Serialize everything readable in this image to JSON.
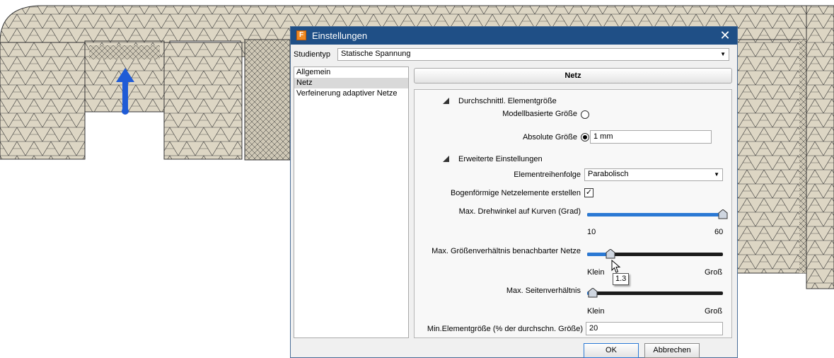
{
  "dialog": {
    "title": "Einstellungen",
    "close_glyph": "✕",
    "icon_letter": "F"
  },
  "study": {
    "label": "Studientyp",
    "value": "Statische Spannung"
  },
  "nav": {
    "items": [
      "Allgemein",
      "Netz",
      "Verfeinerung adaptiver Netze"
    ],
    "selected_index": 1
  },
  "panel": {
    "header": "Netz",
    "avg_section": "Durchschnittl. Elementgröße",
    "model_based_label": "Modellbasierte Größe",
    "absolute_label": "Absolute Größe",
    "absolute_value": "1 mm",
    "advanced_section": "Erweiterte Einstellungen",
    "order_label": "Elementreihenfolge",
    "order_value": "Parabolisch",
    "curved_label": "Bogenförmige Netzelemente erstellen",
    "curved_checked": true,
    "max_angle": {
      "label": "Max. Drehwinkel auf Kurven (Grad)",
      "min_label": "10",
      "max_label": "60",
      "value_fraction": 1.0
    },
    "growth": {
      "label": "Max. Größenverhältnis benachbarter Netze",
      "min_label": "Klein",
      "max_label": "Groß",
      "value_fraction": 0.17,
      "tooltip": "1.3"
    },
    "aspect": {
      "label": "Max. Seitenverhältnis",
      "min_label": "Klein",
      "max_label": "Groß",
      "value_fraction": 0.04
    },
    "min_size_label": "Min.Elementgröße (% der durchschn. Größe)",
    "min_size_value": "20"
  },
  "buttons": {
    "ok": "OK",
    "cancel": "Abbrechen"
  },
  "colors": {
    "mesh_fill": "#ddd6c4",
    "mesh_line": "#3a3a3a",
    "load_arrow": "#1f5bd6",
    "slider_fill": "#2b79d4",
    "title_bar": "#1f4f86"
  },
  "icons": {
    "app": "fusion-icon",
    "close": "close-icon",
    "dropdown": "chevron-down-icon",
    "section": "collapse-triangle-icon",
    "cursor": "mouse-pointer-icon"
  }
}
